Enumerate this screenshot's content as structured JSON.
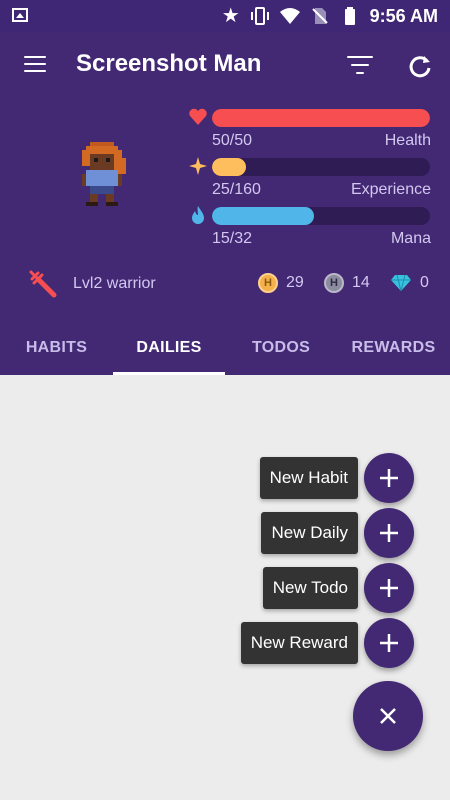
{
  "status_bar": {
    "time": "9:56 AM",
    "icons": [
      "image-icon",
      "star-icon",
      "vibrate-icon",
      "wifi-icon",
      "no-sim-icon",
      "battery-icon"
    ]
  },
  "toolbar": {
    "title": "Screenshot Man",
    "icons": [
      "menu-icon",
      "filter-icon",
      "refresh-icon"
    ]
  },
  "stats": [
    {
      "name": "Health",
      "value": "50/50",
      "fraction": 1.0,
      "color": "#f74e52",
      "icon": "heart-icon"
    },
    {
      "name": "Experience",
      "value": "25/160",
      "fraction": 0.156,
      "color": "#ffbe5d",
      "icon": "star-sparkle-icon"
    },
    {
      "name": "Mana",
      "value": "15/32",
      "fraction": 0.469,
      "color": "#50b5e9",
      "icon": "flame-icon"
    }
  ],
  "player": {
    "class_label": "Lvl2 warrior",
    "gold": "29",
    "hourglasses": "14",
    "gems": "0"
  },
  "tabs": [
    {
      "label": "HABITS",
      "active": false
    },
    {
      "label": "DAILIES",
      "active": true
    },
    {
      "label": "TODOS",
      "active": false
    },
    {
      "label": "REWARDS",
      "active": false
    }
  ],
  "fab_menu": {
    "items": [
      {
        "label": "New Habit"
      },
      {
        "label": "New Daily"
      },
      {
        "label": "New Todo"
      },
      {
        "label": "New Reward"
      }
    ],
    "main_icon": "close-icon"
  },
  "colors": {
    "primary": "#432874",
    "status_bar": "#3f2776",
    "background": "#ececec",
    "label_bg": "#333333"
  }
}
